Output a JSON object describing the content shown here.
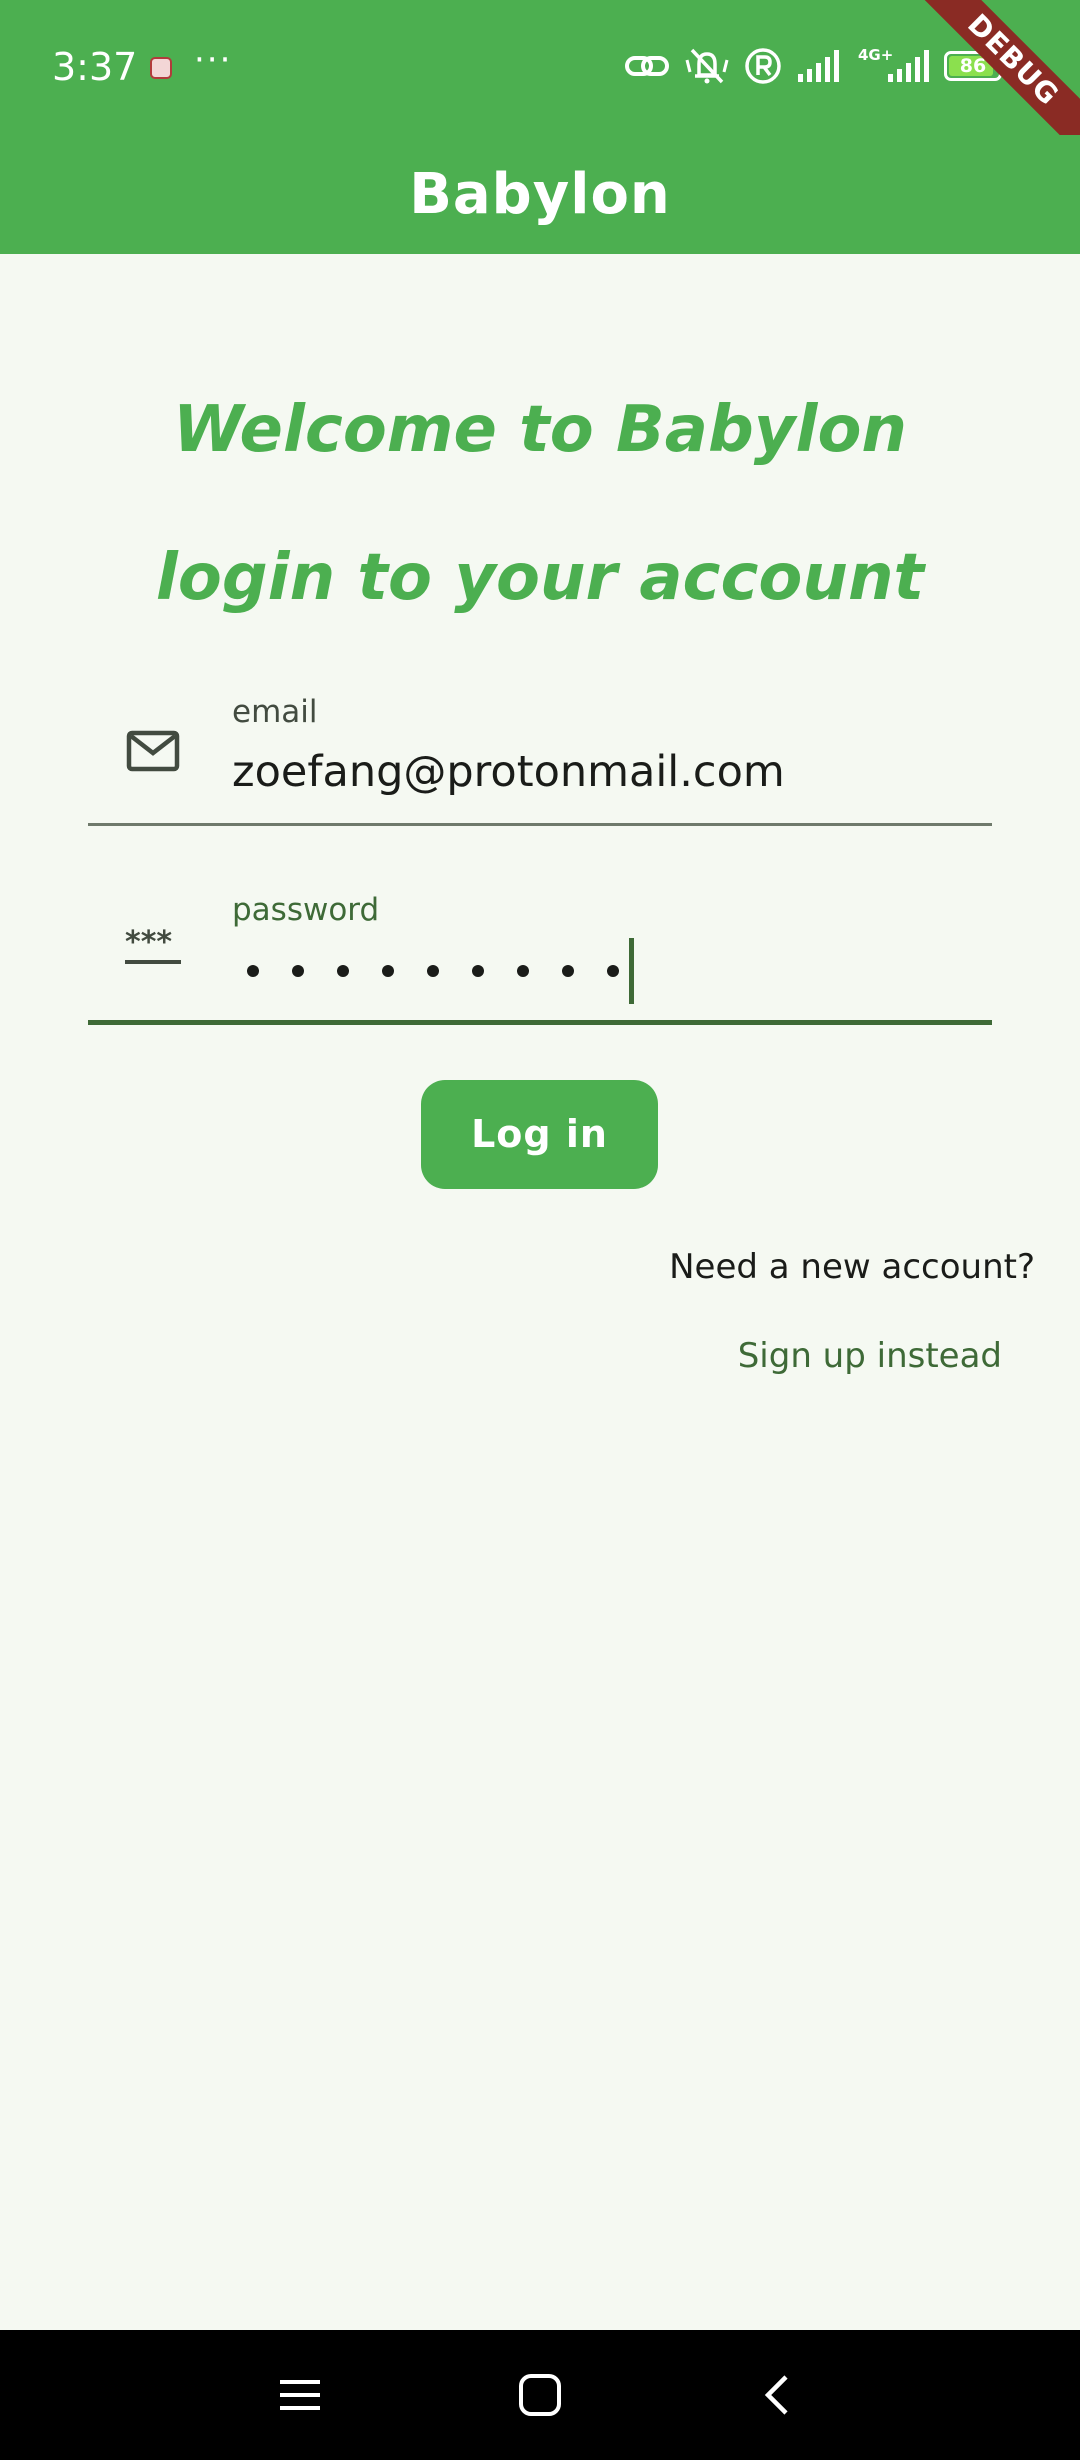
{
  "status_bar": {
    "time": "3:37",
    "more_indicator": "···",
    "network_label": "4G+",
    "battery_level": "86",
    "icons": [
      "app-notification-icon",
      "link-icon",
      "silent-icon",
      "registered-icon",
      "signal-icon",
      "mobile-data-icon",
      "battery-icon"
    ]
  },
  "debug_banner": "DEBUG",
  "app_bar": {
    "title": "Babylon"
  },
  "main": {
    "welcome": "Welcome to Babylon",
    "subtitle": "login to your account",
    "email": {
      "label": "email",
      "value": "zoefang@protonmail.com",
      "icon": "mail-icon"
    },
    "password": {
      "label": "password",
      "dot_count": 9,
      "icon": "password-icon"
    },
    "login_button": "Log in",
    "need_account": "Need a new account?",
    "signup_link": "Sign up instead"
  },
  "nav_bar": {
    "buttons": [
      "menu-icon",
      "home-icon",
      "back-icon"
    ]
  },
  "colors": {
    "primary": "#4caf50",
    "background": "#f5f9f2",
    "dark_green": "#3e6a37",
    "debug": "#8a2b24"
  }
}
